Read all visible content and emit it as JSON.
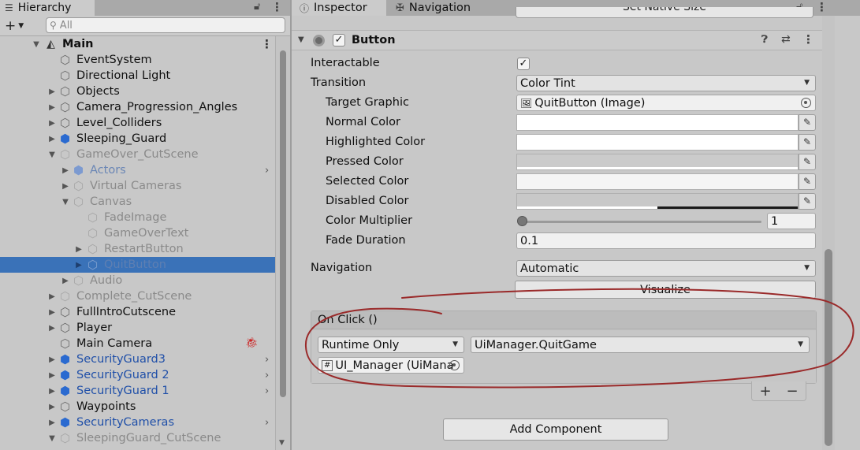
{
  "hierarchy": {
    "tab_label": "Hierarchy",
    "search_placeholder": "All",
    "scene_name": "Main",
    "items": [
      {
        "label": "EventSystem"
      },
      {
        "label": "Directional Light"
      },
      {
        "label": "Objects"
      },
      {
        "label": "Camera_Progression_Angles"
      },
      {
        "label": "Level_Colliders"
      },
      {
        "label": "Sleeping_Guard"
      },
      {
        "label": "GameOver_CutScene"
      },
      {
        "label": "Actors"
      },
      {
        "label": "Virtual Cameras"
      },
      {
        "label": "Canvas"
      },
      {
        "label": "FadeImage"
      },
      {
        "label": "GameOverText"
      },
      {
        "label": "RestartButton"
      },
      {
        "label": "QuitButton"
      },
      {
        "label": "Audio"
      },
      {
        "label": "Complete_CutScene"
      },
      {
        "label": "FullIntroCutscene"
      },
      {
        "label": "Player"
      },
      {
        "label": "Main Camera"
      },
      {
        "label": "SecurityGuard3"
      },
      {
        "label": "SecurityGuard 2"
      },
      {
        "label": "SecurityGuard 1"
      },
      {
        "label": "Waypoints"
      },
      {
        "label": "SecurityCameras"
      },
      {
        "label": "SleepingGuard_CutScene"
      }
    ]
  },
  "inspector": {
    "tabs": [
      {
        "label": "Inspector"
      },
      {
        "label": "Navigation"
      }
    ],
    "top_button": "Set Native Size",
    "component": {
      "title": "Button",
      "enabled": true,
      "interactable_label": "Interactable",
      "interactable_checked": true,
      "transition_label": "Transition",
      "transition_value": "Color Tint",
      "target_graphic_label": "Target Graphic",
      "target_graphic_value": "QuitButton (Image)",
      "normal_color_label": "Normal Color",
      "highlighted_color_label": "Highlighted Color",
      "pressed_color_label": "Pressed Color",
      "selected_color_label": "Selected Color",
      "disabled_color_label": "Disabled Color",
      "color_multiplier_label": "Color Multiplier",
      "color_multiplier_value": "1",
      "fade_duration_label": "Fade Duration",
      "fade_duration_value": "0.1",
      "navigation_label": "Navigation",
      "navigation_value": "Automatic",
      "visualize_button": "Visualize",
      "onclick_header": "On Click ()",
      "runtime_value": "Runtime Only",
      "function_value": "UiManager.QuitGame",
      "object_value": "UI_Manager (UiMana"
    },
    "add_component_button": "Add Component"
  },
  "colors": {
    "selection": "#3a72b8",
    "prefab_blue": "#1f4fa8",
    "annotation_red": "#9a2a2a"
  }
}
